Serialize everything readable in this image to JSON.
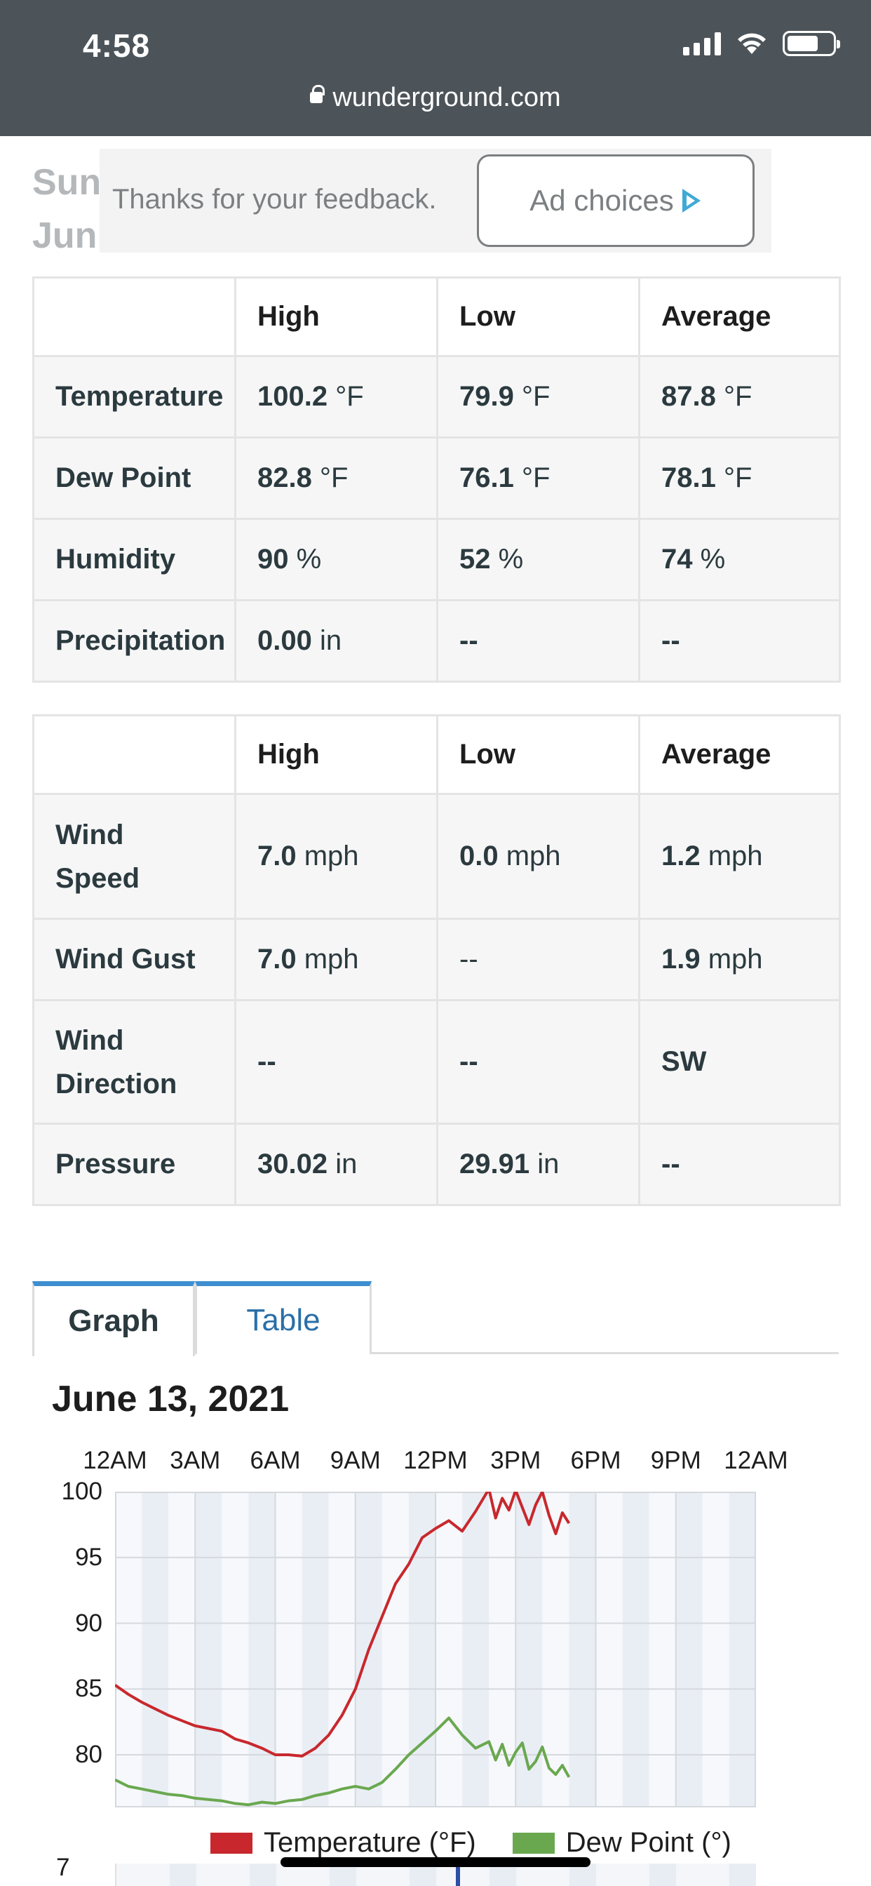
{
  "status_bar": {
    "time": "4:58"
  },
  "browser": {
    "url": "wunderground.com"
  },
  "date_header": {
    "line1": "Sun",
    "line2": "Jun"
  },
  "ad": {
    "feedback": "Thanks for your feedback.",
    "ad_choices": "Ad choices"
  },
  "table1": {
    "headers": [
      "",
      "High",
      "Low",
      "Average"
    ],
    "rows": [
      {
        "label": "Temperature",
        "cells": [
          {
            "v": "100.2",
            "u": " °F"
          },
          {
            "v": "79.9",
            "u": " °F"
          },
          {
            "v": "87.8",
            "u": " °F"
          }
        ]
      },
      {
        "label": "Dew Point",
        "cells": [
          {
            "v": "82.8",
            "u": " °F"
          },
          {
            "v": "76.1",
            "u": " °F"
          },
          {
            "v": "78.1",
            "u": " °F"
          }
        ]
      },
      {
        "label": "Humidity",
        "cells": [
          {
            "v": "90",
            "u": " %"
          },
          {
            "v": "52",
            "u": " %"
          },
          {
            "v": "74",
            "u": " %"
          }
        ]
      },
      {
        "label": "Precipitation",
        "cells": [
          {
            "v": "0.00",
            "u": " in"
          },
          {
            "v": "--",
            "u": ""
          },
          {
            "v": "--",
            "u": ""
          }
        ]
      }
    ]
  },
  "table2": {
    "headers": [
      "",
      "High",
      "Low",
      "Average"
    ],
    "rows": [
      {
        "label": "Wind Speed",
        "cells": [
          {
            "v": "7.0",
            "u": " mph"
          },
          {
            "v": "0.0",
            "u": " mph"
          },
          {
            "v": "1.2",
            "u": " mph"
          }
        ]
      },
      {
        "label": "Wind Gust",
        "cells": [
          {
            "v": "7.0",
            "u": " mph"
          },
          {
            "v": "",
            "u": "--"
          },
          {
            "v": "1.9",
            "u": " mph"
          }
        ]
      },
      {
        "label": "Wind Direction",
        "cells": [
          {
            "v": "--",
            "u": ""
          },
          {
            "v": "--",
            "u": ""
          },
          {
            "v": "SW",
            "u": ""
          }
        ]
      },
      {
        "label": "Pressure",
        "cells": [
          {
            "v": "30.02",
            "u": " in"
          },
          {
            "v": "29.91",
            "u": " in"
          },
          {
            "v": "--",
            "u": ""
          }
        ]
      }
    ]
  },
  "tabs": {
    "graph": "Graph",
    "table": "Table"
  },
  "chart_title": "June 13, 2021",
  "chart_data": {
    "type": "line",
    "x_tick_labels": [
      "12AM",
      "3AM",
      "6AM",
      "9AM",
      "12PM",
      "3PM",
      "6PM",
      "9PM",
      "12AM"
    ],
    "x_hours": [
      0,
      3,
      6,
      9,
      12,
      15,
      18,
      21,
      24
    ],
    "y_tick_labels": [
      "100",
      "95",
      "90",
      "85",
      "80"
    ],
    "y_ticks": [
      100,
      95,
      90,
      85,
      80
    ],
    "ylim": [
      76,
      100
    ],
    "xlim": [
      0,
      24
    ],
    "grid": true,
    "legend_position": "bottom",
    "series": [
      {
        "name": "Temperature (°F)",
        "color": "#c8282d",
        "x": [
          0,
          0.5,
          1,
          1.5,
          2,
          2.5,
          3,
          3.5,
          4,
          4.5,
          5,
          5.5,
          6,
          6.5,
          7,
          7.5,
          8,
          8.5,
          9,
          9.5,
          10,
          10.5,
          11,
          11.5,
          12,
          12.5,
          13,
          13.5,
          14,
          14.25,
          14.5,
          14.75,
          15,
          15.25,
          15.5,
          15.75,
          16,
          16.25,
          16.5,
          16.75,
          17
        ],
        "y": [
          85.3,
          84.6,
          84.0,
          83.5,
          83.0,
          82.6,
          82.2,
          82.0,
          81.8,
          81.2,
          80.9,
          80.5,
          80.0,
          80.0,
          79.9,
          80.5,
          81.5,
          83.0,
          85.0,
          88.0,
          90.5,
          93.0,
          94.5,
          96.5,
          97.2,
          97.8,
          97.0,
          98.5,
          100.2,
          98.0,
          99.5,
          98.6,
          100.1,
          98.8,
          97.5,
          99.0,
          100.0,
          98.2,
          96.8,
          98.4,
          97.6
        ]
      },
      {
        "name": "Dew Point (°)",
        "color": "#6aa84f",
        "x": [
          0,
          0.5,
          1,
          1.5,
          2,
          2.5,
          3,
          3.5,
          4,
          4.5,
          5,
          5.5,
          6,
          6.5,
          7,
          7.5,
          8,
          8.5,
          9,
          9.5,
          10,
          10.5,
          11,
          11.5,
          12,
          12.5,
          13,
          13.5,
          14,
          14.25,
          14.5,
          14.75,
          15,
          15.25,
          15.5,
          15.75,
          16,
          16.25,
          16.5,
          16.75,
          17
        ],
        "y": [
          78.1,
          77.6,
          77.4,
          77.2,
          77.0,
          76.9,
          76.7,
          76.6,
          76.5,
          76.3,
          76.2,
          76.4,
          76.3,
          76.5,
          76.6,
          76.9,
          77.1,
          77.4,
          77.6,
          77.4,
          77.9,
          78.9,
          80.0,
          80.9,
          81.8,
          82.8,
          81.5,
          80.5,
          81.0,
          79.6,
          80.8,
          79.2,
          80.2,
          80.9,
          78.9,
          79.5,
          80.6,
          79.0,
          78.5,
          79.2,
          78.3
        ]
      }
    ]
  },
  "chart2": {
    "y_label": "7"
  }
}
